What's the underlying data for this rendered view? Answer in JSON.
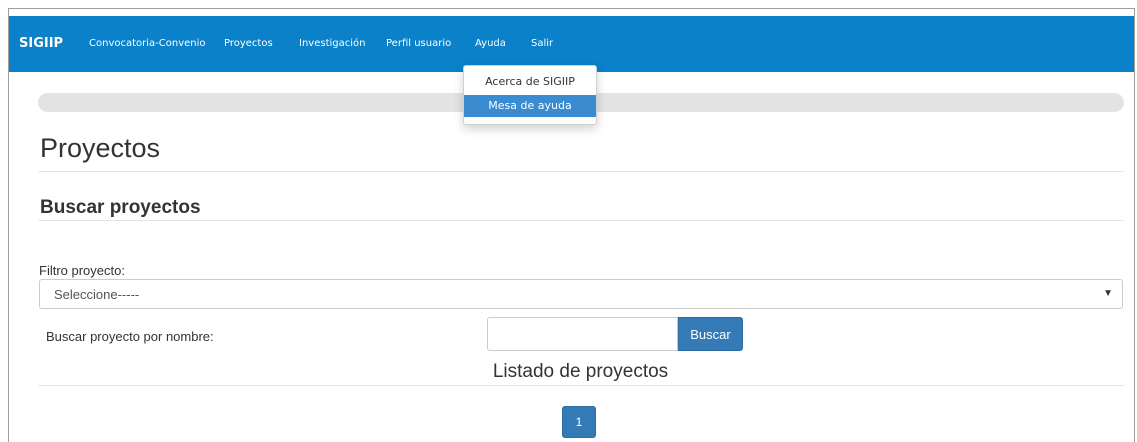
{
  "navbar": {
    "brand": "SIGIIP",
    "items": [
      {
        "label": "Convocatoria-Convenio"
      },
      {
        "label": "Proyectos"
      },
      {
        "label": "Investigación"
      },
      {
        "label": "Perfil usuario"
      },
      {
        "label": "Ayuda"
      },
      {
        "label": "Salir"
      }
    ],
    "background": "#0a81c8"
  },
  "dropdown": {
    "items": [
      {
        "label": "Acerca de SIGIIP"
      },
      {
        "label": "Mesa de ayuda"
      }
    ],
    "highlighted": "Mesa de ayuda"
  },
  "progress": {
    "value": 0
  },
  "page": {
    "title": "Proyectos",
    "section_title": "Buscar proyectos"
  },
  "filter": {
    "label": "Filtro proyecto:",
    "selected": "Seleccione-----"
  },
  "search": {
    "label": "Buscar proyecto por nombre:",
    "value": "",
    "placeholder": "",
    "button_label": "Buscar"
  },
  "list": {
    "title": "Listado de proyectos"
  },
  "pagination": {
    "current_page": "1"
  },
  "colors": {
    "accent": "#337ab7",
    "dropdown_highlight": "#3a8bd0",
    "progress_track": "#e3e3e3"
  }
}
